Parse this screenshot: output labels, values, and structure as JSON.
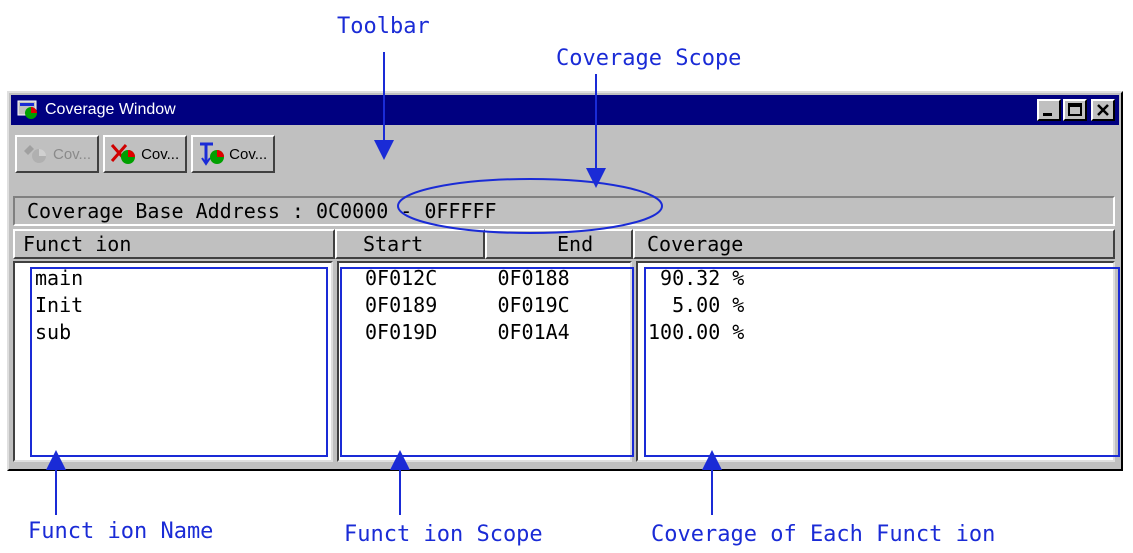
{
  "callouts": {
    "toolbar": "Toolbar",
    "coverage_scope": "Coverage Scope",
    "function_name": "Funct ion Name",
    "function_scope": "Funct ion Scope",
    "coverage_each": "Coverage of Each Funct ion"
  },
  "window": {
    "title": "Coverage Window",
    "minimize_label": "_",
    "maximize_label": "□",
    "close_label": "×"
  },
  "toolbar": [
    {
      "label": "Cov...",
      "icon": "coverage-set-icon",
      "enabled": false
    },
    {
      "label": "Cov...",
      "icon": "coverage-clear-icon",
      "enabled": true
    },
    {
      "label": "Cov...",
      "icon": "coverage-range-icon",
      "enabled": true
    }
  ],
  "scope": {
    "label": "Coverage Base Address : ",
    "range": "0C0000 - 0FFFFF"
  },
  "columns": {
    "function": "Funct ion",
    "start": "Start",
    "end": "End",
    "coverage": "Coverage"
  },
  "rows": [
    {
      "function": "main",
      "start": "0F012C",
      "end": "0F0188",
      "coverage": " 90.32 %"
    },
    {
      "function": "Init",
      "start": "0F0189",
      "end": "0F019C",
      "coverage": "  5.00 %"
    },
    {
      "function": "sub",
      "start": "0F019D",
      "end": "0F01A4",
      "coverage": "100.00 %"
    }
  ],
  "colors": {
    "annotation": "#1a2bd6",
    "titlebar": "#000080",
    "window_face": "#c0c0c0"
  }
}
